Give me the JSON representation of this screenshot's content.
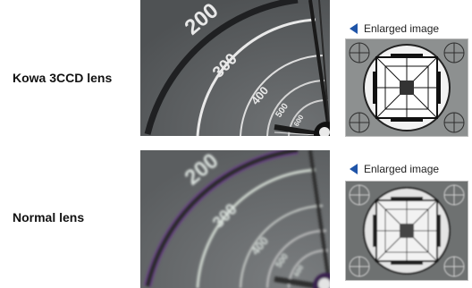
{
  "rows": [
    {
      "label": "Kowa 3CCD lens",
      "enlarged_label": "Enlarged image",
      "scale_numbers": [
        "200",
        "300",
        "400",
        "500",
        "600"
      ]
    },
    {
      "label": "Normal lens",
      "enlarged_label": "Enlarged image",
      "scale_numbers": [
        "200",
        "300",
        "400",
        "500",
        "600"
      ]
    }
  ],
  "colors": {
    "arrow": "#1f54a8",
    "lens_bg": "#5a5d5f",
    "blurry_fringe": "#6b3a8c"
  }
}
